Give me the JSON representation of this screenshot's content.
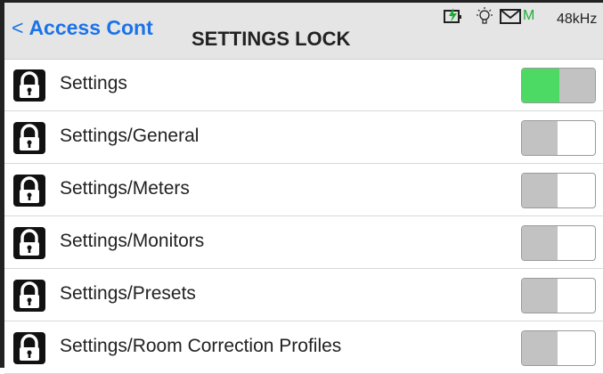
{
  "header": {
    "back_label": "Access Cont",
    "title": "SETTINGS LOCK",
    "status": {
      "icons": [
        "battery-charging-icon",
        "light-bulb-icon",
        "mail-icon"
      ],
      "m_label": "M",
      "m_color": "#1fad3a",
      "sample_rate": "48kHz"
    }
  },
  "colors": {
    "accent": "#1a73e8",
    "toggle_on": "#4cd964",
    "toggle_knob": "#c2c2c2"
  },
  "items": [
    {
      "label": "Settings",
      "on": true
    },
    {
      "label": "Settings/General",
      "on": false
    },
    {
      "label": "Settings/Meters",
      "on": false
    },
    {
      "label": "Settings/Monitors",
      "on": false
    },
    {
      "label": "Settings/Presets",
      "on": false
    },
    {
      "label": "Settings/Room Correction Profiles",
      "on": false
    }
  ]
}
